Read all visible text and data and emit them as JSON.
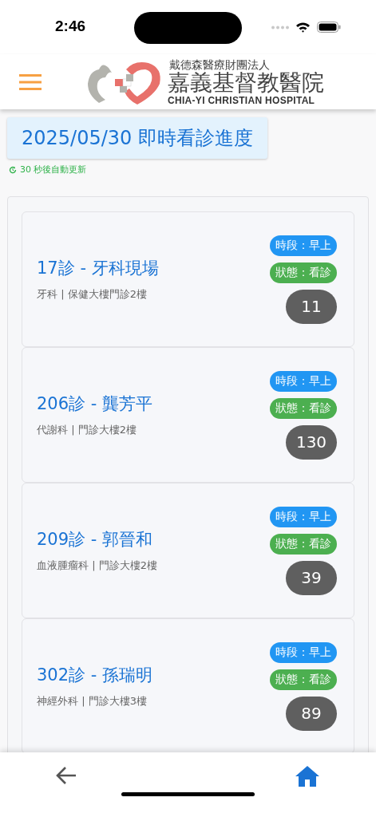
{
  "status_bar": {
    "time": "2:46"
  },
  "header": {
    "org": "戴德森醫療財團法人",
    "hospital": "嘉義基督教醫院",
    "english": "CHIA-YI CHRISTIAN HOSPITAL"
  },
  "title": "2025/05/30 即時看診進度",
  "refresh": "30 秒後自動更新",
  "clinics": [
    {
      "name": "17診 - 牙科現場",
      "detail": "牙科 | 保健大樓門診2樓",
      "period": "時段：早上",
      "status": "狀態：看診",
      "number": "11"
    },
    {
      "name": "206診 - 龔芳平",
      "detail": "代謝科 | 門診大樓2樓",
      "period": "時段：早上",
      "status": "狀態：看診",
      "number": "130"
    },
    {
      "name": "209診 - 郭晉和",
      "detail": "血液腫瘤科 | 門診大樓2樓",
      "period": "時段：早上",
      "status": "狀態：看診",
      "number": "39"
    },
    {
      "name": "302診 - 孫瑞明",
      "detail": "神經外科 | 門診大樓3樓",
      "period": "時段：早上",
      "status": "狀態：看診",
      "number": "89"
    }
  ]
}
